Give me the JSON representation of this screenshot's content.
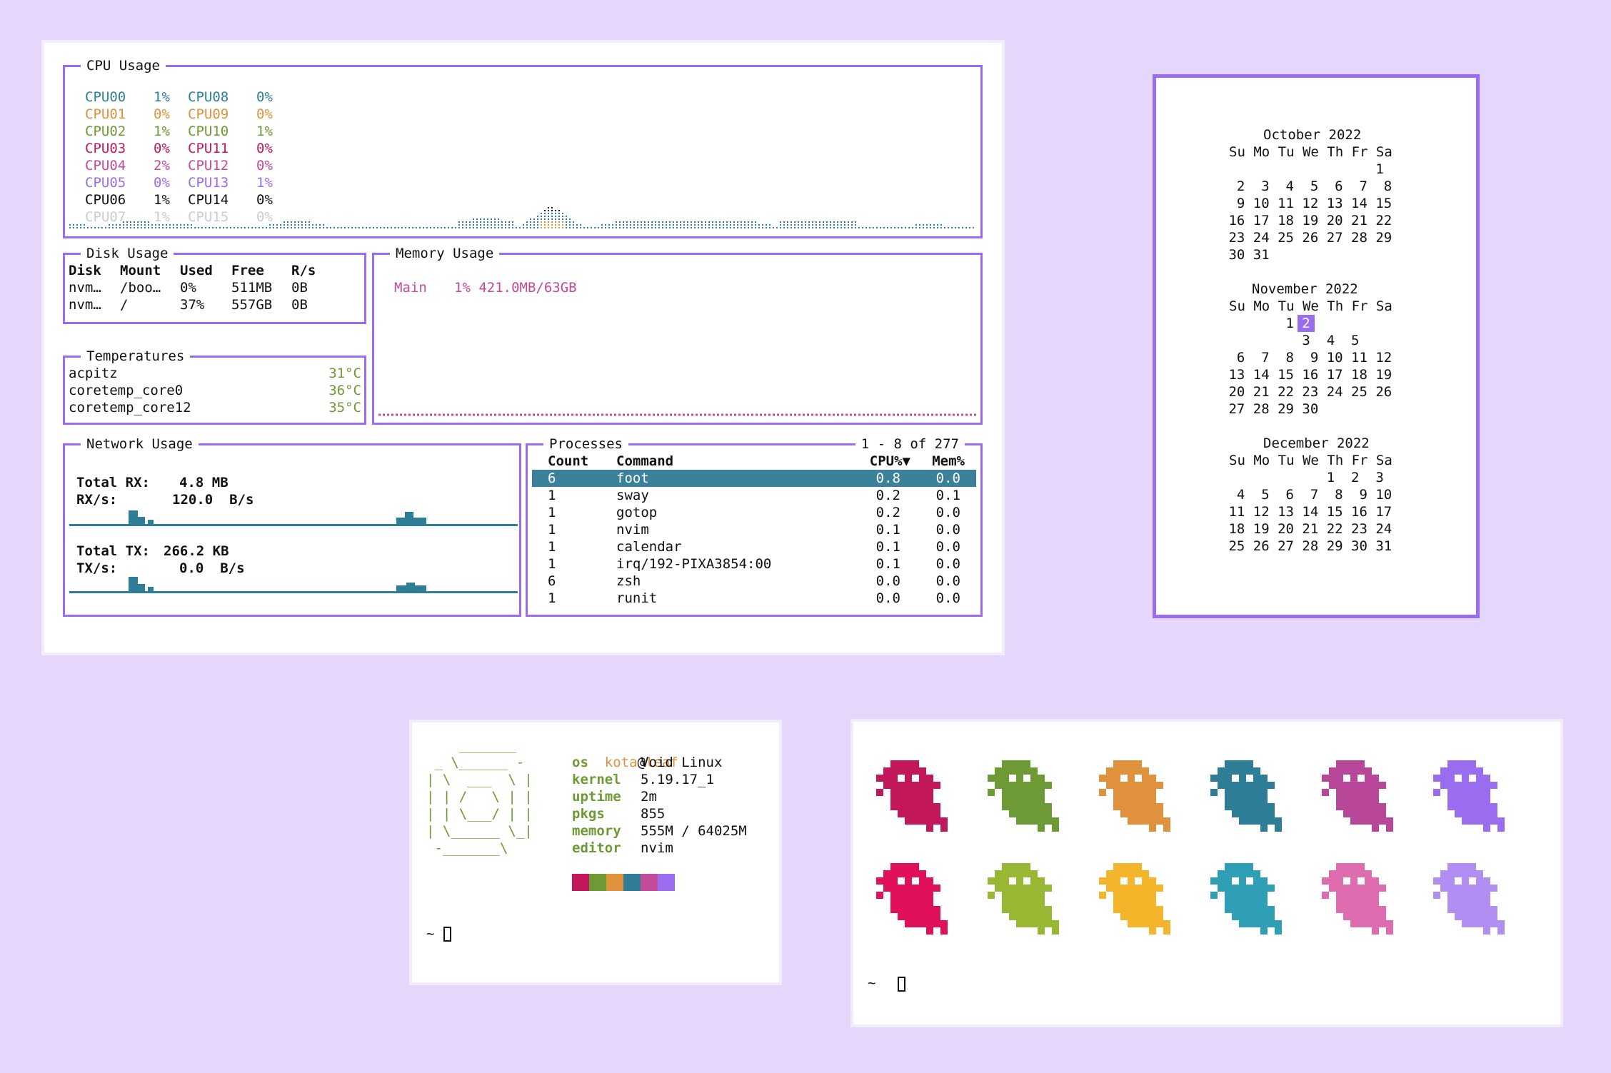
{
  "colors": {
    "background": "#e5d7fb",
    "accent": "#9a6cf0",
    "teal": "#2f7e98",
    "orange": "#e0913c",
    "green": "#6e9a36",
    "crimson": "#c2185b",
    "magenta": "#c44a9a",
    "purple": "#9a6cf0"
  },
  "gotop": {
    "cpu": {
      "title": "CPU Usage",
      "cores": [
        {
          "name": "CPU00",
          "pct": "1%",
          "color": "#2f7e98"
        },
        {
          "name": "CPU01",
          "pct": "0%",
          "color": "#e0913c"
        },
        {
          "name": "CPU02",
          "pct": "1%",
          "color": "#6e9a36"
        },
        {
          "name": "CPU03",
          "pct": "0%",
          "color": "#c2185b"
        },
        {
          "name": "CPU04",
          "pct": "2%",
          "color": "#c44a9a"
        },
        {
          "name": "CPU05",
          "pct": "0%",
          "color": "#9a6cf0"
        },
        {
          "name": "CPU06",
          "pct": "1%",
          "color": "#111111"
        },
        {
          "name": "CPU07",
          "pct": "1%",
          "color": "#cccccc"
        },
        {
          "name": "CPU08",
          "pct": "0%",
          "color": "#2f7e98"
        },
        {
          "name": "CPU09",
          "pct": "0%",
          "color": "#e0913c"
        },
        {
          "name": "CPU10",
          "pct": "1%",
          "color": "#6e9a36"
        },
        {
          "name": "CPU11",
          "pct": "0%",
          "color": "#c2185b"
        },
        {
          "name": "CPU12",
          "pct": "0%",
          "color": "#c44a9a"
        },
        {
          "name": "CPU13",
          "pct": "1%",
          "color": "#9a6cf0"
        },
        {
          "name": "CPU14",
          "pct": "0%",
          "color": "#111111"
        },
        {
          "name": "CPU15",
          "pct": "0%",
          "color": "#cccccc"
        }
      ]
    },
    "disk": {
      "title": "Disk Usage",
      "headers": [
        "Disk",
        "Mount",
        "Used",
        "Free",
        "R/s"
      ],
      "rows": [
        [
          "nvm…",
          "/boo…",
          "0%",
          "511MB",
          "0B"
        ],
        [
          "nvm…",
          "/",
          "37%",
          "557GB",
          "0B"
        ]
      ]
    },
    "temps": {
      "title": "Temperatures",
      "rows": [
        {
          "name": "acpitz",
          "value": "31°C"
        },
        {
          "name": "coretemp_core0",
          "value": "36°C"
        },
        {
          "name": "coretemp_core12",
          "value": "35°C"
        }
      ]
    },
    "memory": {
      "title": "Memory Usage",
      "main_label": "Main",
      "main_value": "1% 421.0MB/63GB"
    },
    "network": {
      "title": "Network Usage",
      "rx_total_label": "Total RX:",
      "rx_total": "4.8 MB",
      "rx_rate_label": "RX/s:",
      "rx_rate": "120.0  B/s",
      "tx_total_label": "Total TX:",
      "tx_total": "266.2 KB",
      "tx_rate_label": "TX/s:",
      "tx_rate": "0.0  B/s"
    },
    "processes": {
      "title": "Processes",
      "range": "1 - 8 of 277",
      "headers": [
        "Count",
        "Command",
        "CPU%▼",
        "Mem%"
      ],
      "rows": [
        [
          "6",
          "foot",
          "0.8",
          "0.0"
        ],
        [
          "1",
          "sway",
          "0.2",
          "0.1"
        ],
        [
          "1",
          "gotop",
          "0.2",
          "0.0"
        ],
        [
          "1",
          "nvim",
          "0.1",
          "0.0"
        ],
        [
          "1",
          "calendar",
          "0.1",
          "0.0"
        ],
        [
          "1",
          "irq/192-PIXA3854:00",
          "0.1",
          "0.0"
        ],
        [
          "6",
          "zsh",
          "0.0",
          "0.0"
        ],
        [
          "1",
          "runit",
          "0.0",
          "0.0"
        ]
      ]
    }
  },
  "calendar": {
    "months": [
      {
        "title": "October 2022",
        "header": "Su Mo Tu We Th Fr Sa",
        "lines": [
          "                   1",
          "  2  3  4  5  6  7  8",
          "  9 10 11 12 13 14 15",
          " 16 17 18 19 20 21 22",
          " 23 24 25 26 27 28 29",
          " 30 31"
        ]
      },
      {
        "title": "November 2022",
        "header": "Su Mo Tu We Th Fr Sa",
        "lines": [
          "        1 ",
          "          3  4  5",
          "  6  7  8  9 10 11 12",
          " 13 14 15 16 17 18 19",
          " 20 21 22 23 24 25 26",
          " 27 28 29 30"
        ],
        "today": "2"
      },
      {
        "title": "December 2022",
        "header": "Su Mo Tu We Th Fr Sa",
        "lines": [
          "             1  2  3",
          "  4  5  6  7  8  9 10",
          " 11 12 13 14 15 16 17",
          " 18 19 20 21 22 23 24",
          " 25 26 27 28 29 30 31"
        ]
      }
    ]
  },
  "fetch": {
    "user": "kota",
    "at": "@",
    "host": "leaf",
    "logo": [
      "    _______",
      " _ \\______ -",
      "| \\  ___  \\ |",
      "| | /   \\ | |",
      "| | \\___/ | |",
      "| \\______ \\_|",
      " -_______\\"
    ],
    "fields": [
      {
        "key": "os",
        "value": "Void Linux"
      },
      {
        "key": "kernel",
        "value": "5.19.17_1"
      },
      {
        "key": "uptime",
        "value": "2m"
      },
      {
        "key": "pkgs",
        "value": "855"
      },
      {
        "key": "memory",
        "value": "555M / 64025M"
      },
      {
        "key": "editor",
        "value": "nvim"
      }
    ],
    "palette": [
      "#c2185b",
      "#6e9a36",
      "#e0913c",
      "#2f7e98",
      "#c44a9a",
      "#9a6cf0"
    ],
    "prompt": "~"
  },
  "ghosts": {
    "row1": [
      "#c2185b",
      "#6e9a36",
      "#e0913c",
      "#2f7e98",
      "#b8479a",
      "#9a6cf0"
    ],
    "row2": [
      "#e0105a",
      "#98b834",
      "#f5b52a",
      "#2e9fb5",
      "#e06cb0",
      "#b08ef2"
    ],
    "prompt": "~"
  }
}
